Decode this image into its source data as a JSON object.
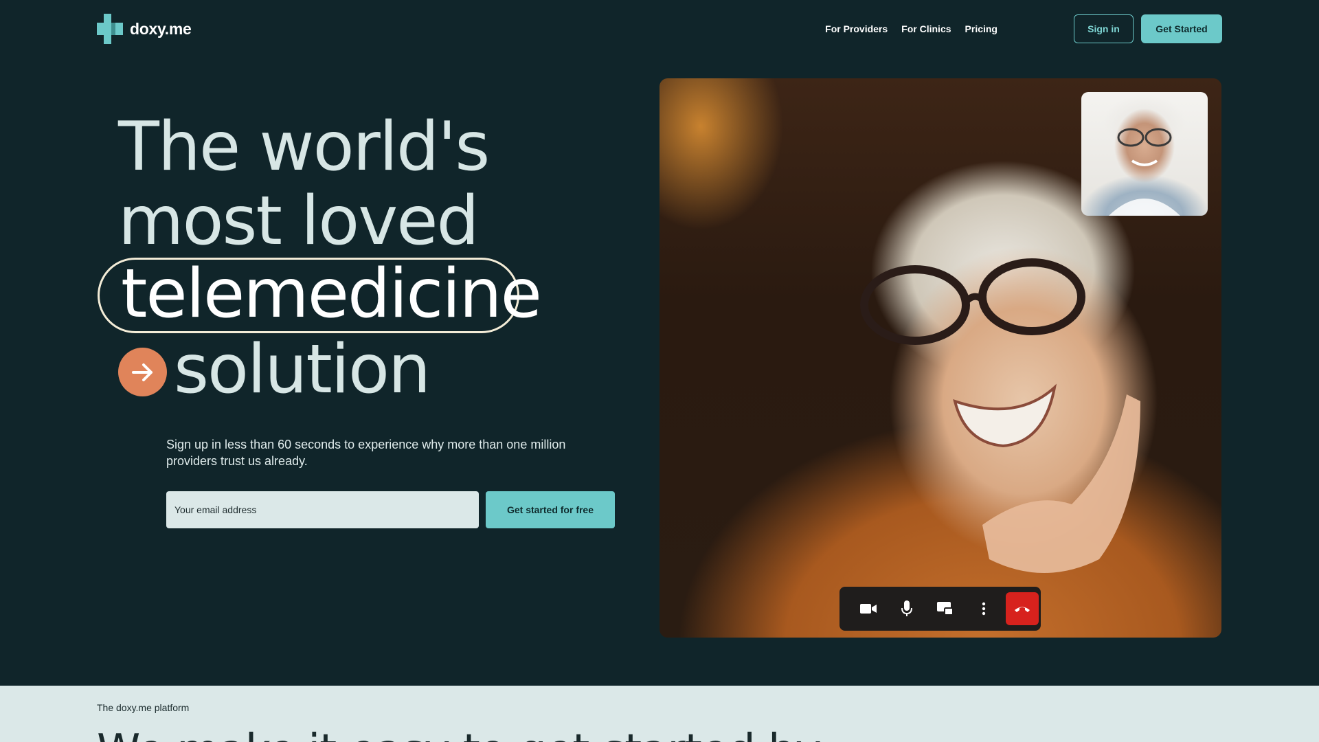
{
  "brand": {
    "name": "doxy.me",
    "accent": "#6cc9c9",
    "background": "#10252a"
  },
  "nav": {
    "items": [
      {
        "label": "For Providers"
      },
      {
        "label": "For Clinics"
      },
      {
        "label": "Pricing"
      }
    ],
    "sign_in": "Sign in",
    "get_started": "Get Started"
  },
  "hero": {
    "line1": "The world's",
    "line2": "most loved",
    "line3": "telemedicine",
    "line4": "solution",
    "arrow_icon": "arrow-right-icon",
    "subtext": "Sign up in less than 60 seconds to experience why more than one million providers trust us already.",
    "email_placeholder": "Your email address",
    "cta": "Get started for free"
  },
  "video_call": {
    "controls": [
      {
        "icon": "camera-icon"
      },
      {
        "icon": "microphone-icon"
      },
      {
        "icon": "screen-share-icon"
      },
      {
        "icon": "more-vertical-icon"
      },
      {
        "icon": "end-call-icon",
        "color": "#d7221d"
      }
    ]
  },
  "platform": {
    "label": "The doxy.me platform",
    "heading": "We make it easy to get started by"
  }
}
